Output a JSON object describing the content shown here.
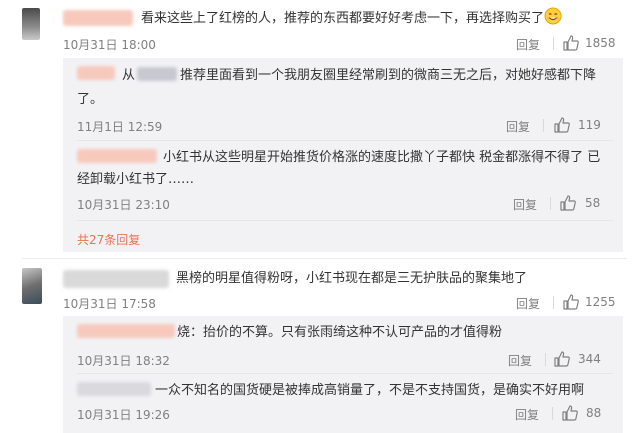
{
  "comments": [
    {
      "text": "看来这些上了红榜的人，推荐的东西都要好好考虑一下，再选择购买了",
      "emoji": "smile-emoji",
      "time": "10月31日 18:00",
      "reply": "回复",
      "likes": "1858",
      "replies": [
        {
          "prefix": "从",
          "text_line1": "推荐里面看到一个我朋友圈里经常刷到的微商三无之后，对她好感都下降",
          "text_line2": "了。",
          "time": "11月1日 12:59",
          "reply": "回复",
          "likes": "119"
        },
        {
          "text_line1": "小红书从这些明星开始推货价格涨的速度比撒丫子都快  税金都涨得不得了 已",
          "text_line2": "经卸载小红书了……",
          "time": "10月31日 23:10",
          "reply": "回复",
          "likes": "58"
        }
      ],
      "more_replies": "共27条回复"
    },
    {
      "text": "黑榜的明星值得粉呀，小红书现在都是三无护肤品的聚集地了",
      "time": "10月31日 17:58",
      "reply": "回复",
      "likes": "1255",
      "replies": [
        {
          "suffix": "烧：抬价的不算。只有张雨绮这种不认可产品的才值得粉",
          "time": "10月31日 18:32",
          "reply": "回复",
          "likes": "344"
        },
        {
          "text": "一众不知名的国货硬是被捧成高销量了，不是不支持国货，是确实不好用啊",
          "time": "10月31日 19:26",
          "reply": "回复",
          "likes": "88"
        }
      ]
    }
  ],
  "colors": {
    "accent": "#eb7350",
    "meta": "#808080",
    "reply_bg": "#f2f2f5"
  }
}
